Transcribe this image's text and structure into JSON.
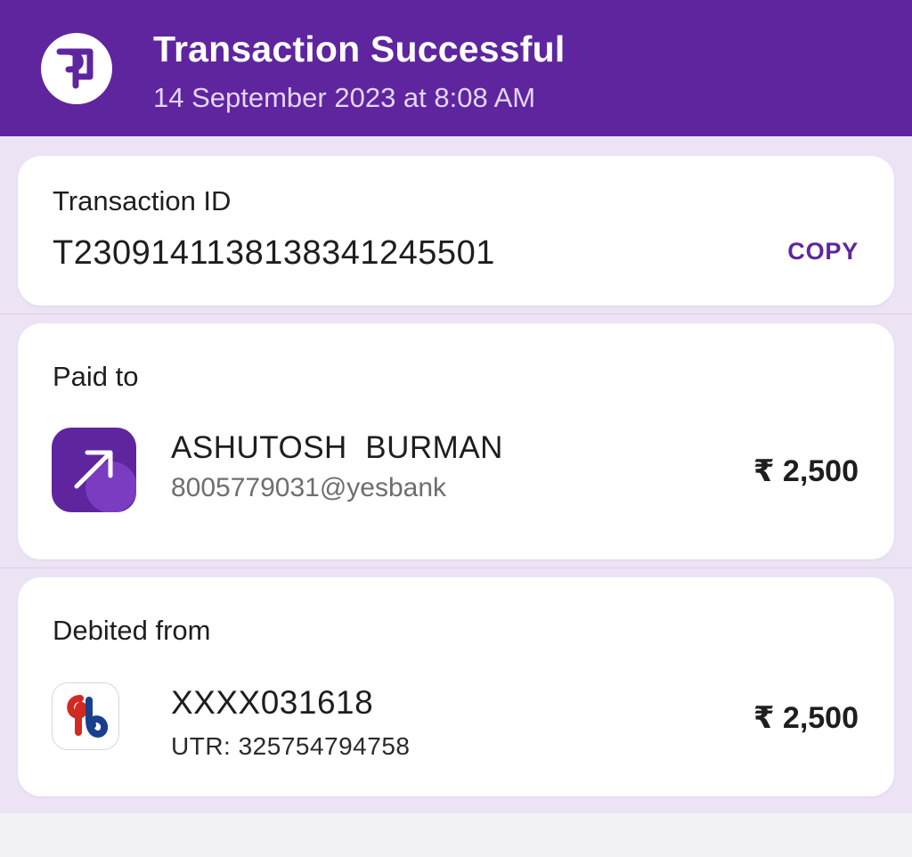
{
  "header": {
    "status_title": "Transaction Successful",
    "datetime": "14 September 2023 at 8:08 AM",
    "logo_icon": "phonepe-logo-icon"
  },
  "transaction_card": {
    "label": "Transaction ID",
    "id": "T2309141138138341245501",
    "copy_label": "COPY"
  },
  "paid_to_card": {
    "label": "Paid to",
    "payee_name": "ASHUTOSH  BURMAN",
    "payee_vpa": "8005779031@yesbank",
    "amount": "₹ 2,500",
    "icon": "arrow-up-right-icon"
  },
  "debited_from_card": {
    "label": "Debited from",
    "account": "XXXX031618",
    "utr": "UTR: 325754794758",
    "amount": "₹ 2,500",
    "icon": "bank-of-baroda-logo-icon"
  },
  "colors": {
    "brand_purple": "#5f259f",
    "background_lavender": "#ece4f5"
  }
}
